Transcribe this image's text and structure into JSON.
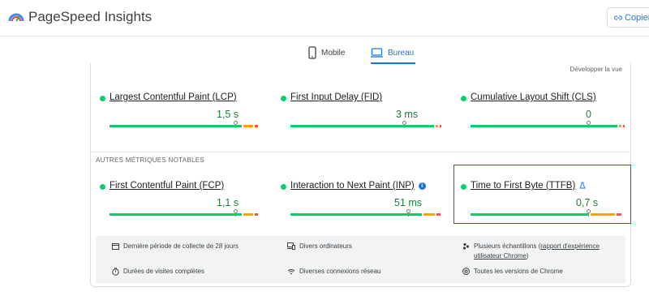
{
  "header": {
    "app_title": "PageSpeed Insights",
    "copy_label": "Copier le lien"
  },
  "tabs": [
    {
      "label": "Mobile",
      "icon": "mobile-icon",
      "active": false
    },
    {
      "label": "Bureau",
      "icon": "desktop-icon",
      "active": true
    }
  ],
  "panel": {
    "expand_label": "Développer la vue",
    "section_label": "AUTRES MÉTRIQUES NOTABLES",
    "core_metrics": [
      {
        "name": "Largest Contentful Paint (LCP)",
        "value": "1,5 s",
        "status_color": "#0cce6b"
      },
      {
        "name": "First Input Delay (FID)",
        "value": "3 ms",
        "status_color": "#0cce6b"
      },
      {
        "name": "Cumulative Layout Shift (CLS)",
        "value": "0",
        "status_color": "#0cce6b"
      }
    ],
    "other_metrics": [
      {
        "name": "First Contentful Paint (FCP)",
        "value": "1,1 s",
        "status_color": "#0cce6b"
      },
      {
        "name": "Interaction to Next Paint (INP)",
        "value": "51 ms",
        "status_color": "#0cce6b",
        "icon": "info-icon"
      },
      {
        "name": "Time to First Byte (TTFB)",
        "value": "0,7 s",
        "status_color": "#0cce6b",
        "icon": "flask-icon",
        "highlighted": true
      }
    ]
  },
  "footer": {
    "collection_period": "Dernière période de collecte de 28 jours",
    "devices": "Divers ordinateurs",
    "samples_prefix": "Plusieurs échantillons (",
    "samples_link": "rapport d'expérience utilisateur Chrome",
    "samples_suffix": ")",
    "visit_durations": "Durées de visites complètes",
    "connections": "Diverses connexions réseau",
    "chrome_versions": "Toutes les versions de Chrome"
  },
  "colors": {
    "good": "#0cce6b",
    "average": "#ffa400",
    "poor": "#ff4e42",
    "accent": "#1a73e8",
    "highlight_border": "#e02020"
  }
}
